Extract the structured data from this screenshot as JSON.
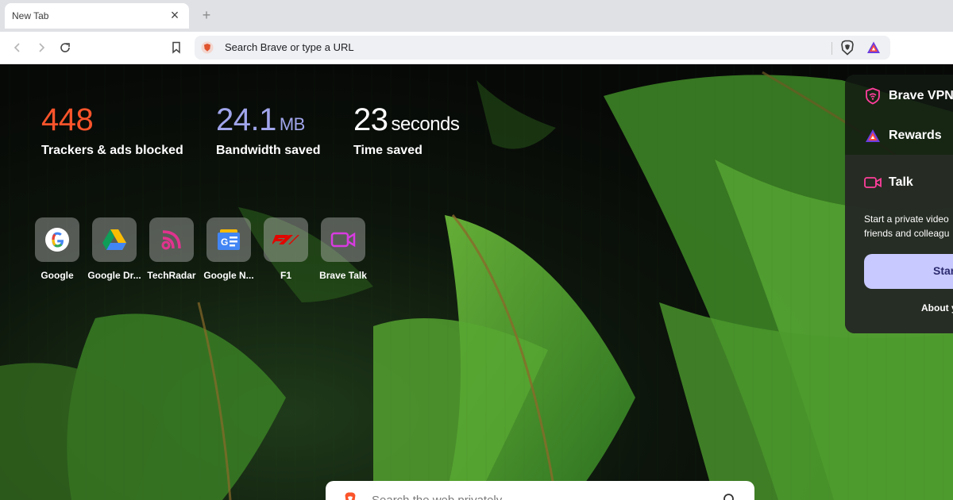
{
  "browser": {
    "tab_title": "New Tab",
    "omnibox_placeholder": "Search Brave or type a URL",
    "colors": {
      "brave_orange": "#fb542b",
      "brave_purple": "#a0a5eb"
    }
  },
  "stats": {
    "trackers": {
      "value": "448",
      "label": "Trackers & ads blocked",
      "color": "#fb542b"
    },
    "bandwidth": {
      "value": "24.1",
      "unit": "MB",
      "label": "Bandwidth saved",
      "color": "#a0a5eb"
    },
    "time": {
      "value": "23",
      "unit": "seconds",
      "label": "Time saved",
      "color": "#ffffff"
    }
  },
  "top_sites": [
    {
      "label": "Google",
      "icon": "google-icon"
    },
    {
      "label": "Google Dr...",
      "icon": "google-drive-icon"
    },
    {
      "label": "TechRadar",
      "icon": "techradar-icon"
    },
    {
      "label": "Google N...",
      "icon": "google-news-icon"
    },
    {
      "label": "F1",
      "icon": "f1-icon"
    },
    {
      "label": "Brave Talk",
      "icon": "brave-talk-icon"
    }
  ],
  "sidebar": {
    "vpn_title": "Brave VPN",
    "rewards_title": "Rewards",
    "talk_title": "Talk",
    "talk_desc_line1": "Start a private video",
    "talk_desc_line2": "friends and colleagu",
    "talk_button": "Star",
    "talk_about": "About y"
  },
  "search": {
    "placeholder": "Search the web privately"
  }
}
